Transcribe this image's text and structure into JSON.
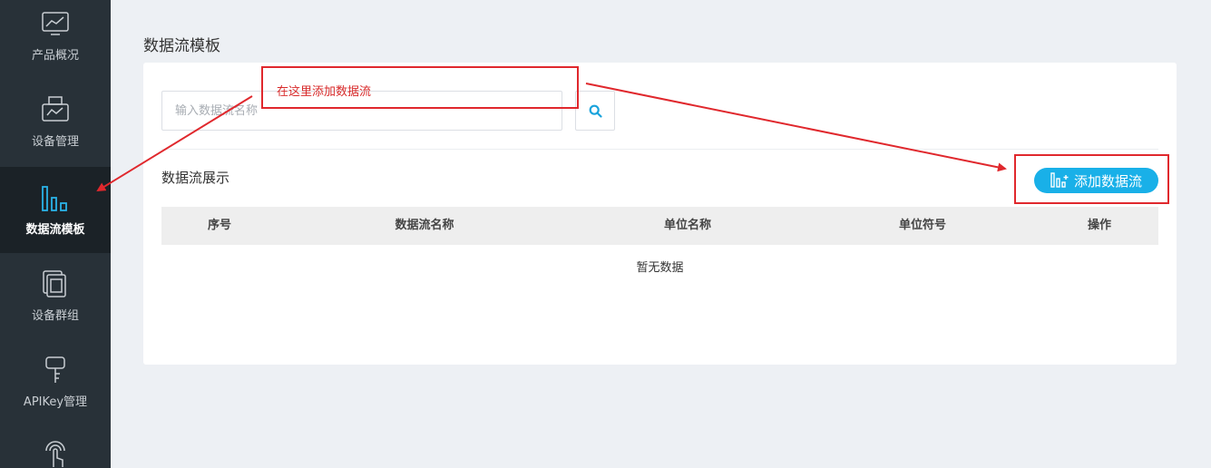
{
  "sidebar": {
    "items": [
      {
        "label": "产品概况",
        "icon": "chart-monitor-icon",
        "active": false
      },
      {
        "label": "设备管理",
        "icon": "printer-icon",
        "active": false
      },
      {
        "label": "数据流模板",
        "icon": "bar-chart-icon",
        "active": true
      },
      {
        "label": "设备群组",
        "icon": "device-stack-icon",
        "active": false
      },
      {
        "label": "APIKey管理",
        "icon": "key-icon",
        "active": false
      },
      {
        "label": "",
        "icon": "touch-signal-icon",
        "active": false
      }
    ]
  },
  "page": {
    "title": "数据流模板"
  },
  "search": {
    "placeholder": "输入数据流名称",
    "value": ""
  },
  "section": {
    "title": "数据流展示"
  },
  "add_button": {
    "label": "添加数据流"
  },
  "table": {
    "headers": [
      "序号",
      "数据流名称",
      "单位名称",
      "单位符号",
      "操作"
    ],
    "rows": [],
    "empty_text": "暂无数据"
  },
  "annotation": {
    "text": "在这里添加数据流",
    "color": "#e0282d"
  },
  "colors": {
    "accent": "#19b0e8",
    "sidebar_bg": "#283138",
    "sidebar_active_bg": "#1b2227",
    "page_bg": "#edf0f4"
  }
}
